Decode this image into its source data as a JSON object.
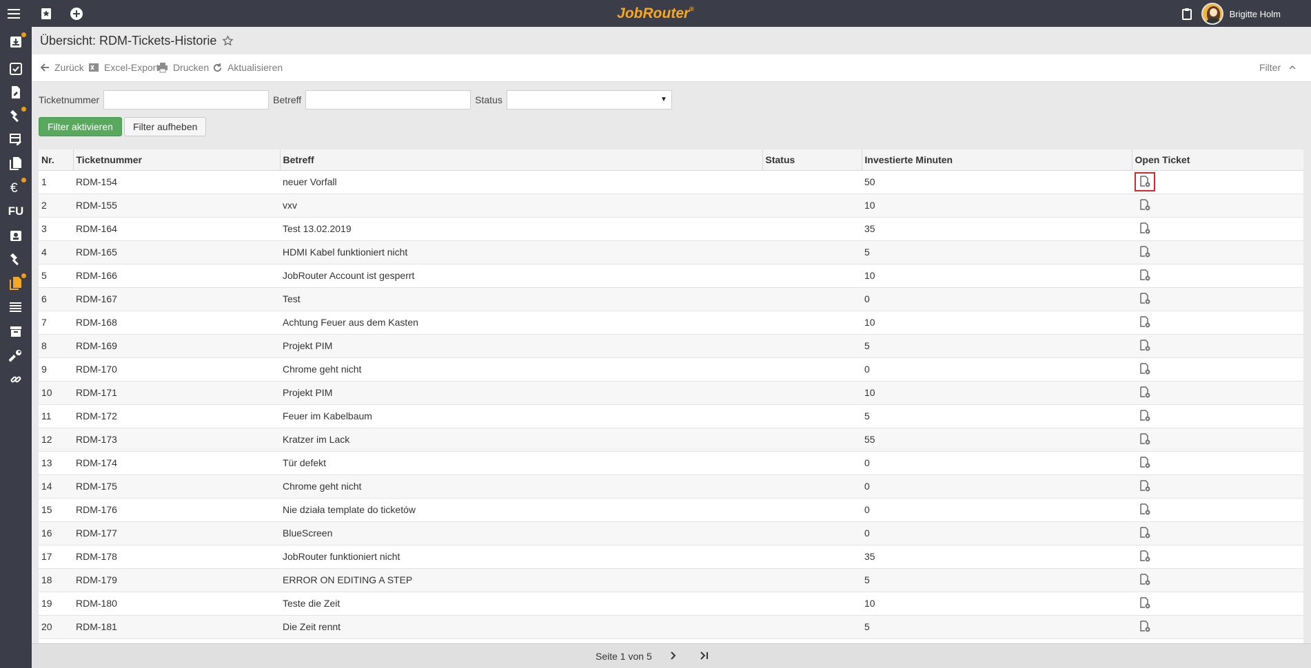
{
  "topbar": {
    "brand": "JobRouter",
    "brand_mark": "®",
    "user_name": "Brigitte Holm",
    "icons": [
      "menu-icon",
      "bookmark-icon",
      "add-circle-icon",
      "clipboard-icon",
      "avatar"
    ]
  },
  "sidebar": {
    "items": [
      {
        "icon": "inbox-icon",
        "badge": true
      },
      {
        "icon": "checkbox-icon",
        "badge": false
      },
      {
        "icon": "document-edit-icon",
        "badge": false
      },
      {
        "icon": "hammer-icon",
        "badge": true
      },
      {
        "icon": "table-edit-icon",
        "badge": false
      },
      {
        "icon": "documents-icon",
        "badge": false
      },
      {
        "icon": "euro-icon",
        "badge": true
      },
      {
        "label": "FU",
        "badge": false
      },
      {
        "icon": "contact-card-icon",
        "badge": false
      },
      {
        "icon": "hammer-icon",
        "badge": false
      },
      {
        "icon": "clipboard-files-icon",
        "badge": true,
        "active": true
      },
      {
        "icon": "list-icon",
        "badge": false
      },
      {
        "icon": "archive-icon",
        "badge": false
      },
      {
        "icon": "wrench-icon",
        "badge": false
      },
      {
        "icon": "link-icon",
        "badge": false
      }
    ]
  },
  "page": {
    "title": "Übersicht: RDM-Tickets-Historie"
  },
  "toolbar": {
    "back": "Zurück",
    "excel": "Excel-Export",
    "print": "Drucken",
    "refresh": "Aktualisieren",
    "filter": "Filter"
  },
  "filters": {
    "ticket_label": "Ticketnummer",
    "ticket_value": "",
    "subject_label": "Betreff",
    "subject_value": "",
    "status_label": "Status",
    "status_value": "",
    "apply": "Filter aktivieren",
    "clear": "Filter aufheben"
  },
  "table": {
    "columns": [
      "Nr.",
      "Ticketnummer",
      "Betreff",
      "Status",
      "Investierte Minuten",
      "Open Ticket"
    ],
    "rows": [
      {
        "nr": "1",
        "ticket": "RDM-154",
        "subject": "neuer Vorfall",
        "status": "",
        "minutes": "50"
      },
      {
        "nr": "2",
        "ticket": "RDM-155",
        "subject": "vxv",
        "status": "",
        "minutes": "10"
      },
      {
        "nr": "3",
        "ticket": "RDM-164",
        "subject": "Test 13.02.2019",
        "status": "",
        "minutes": "35"
      },
      {
        "nr": "4",
        "ticket": "RDM-165",
        "subject": "HDMI Kabel funktioniert nicht",
        "status": "",
        "minutes": "5"
      },
      {
        "nr": "5",
        "ticket": "RDM-166",
        "subject": "JobRouter Account ist gesperrt",
        "status": "",
        "minutes": "10"
      },
      {
        "nr": "6",
        "ticket": "RDM-167",
        "subject": "Test",
        "status": "",
        "minutes": "0"
      },
      {
        "nr": "7",
        "ticket": "RDM-168",
        "subject": "Achtung Feuer aus dem Kasten",
        "status": "",
        "minutes": "10"
      },
      {
        "nr": "8",
        "ticket": "RDM-169",
        "subject": "Projekt PIM",
        "status": "",
        "minutes": "5"
      },
      {
        "nr": "9",
        "ticket": "RDM-170",
        "subject": "Chrome geht nicht",
        "status": "",
        "minutes": "0"
      },
      {
        "nr": "10",
        "ticket": "RDM-171",
        "subject": "Projekt PIM",
        "status": "",
        "minutes": "10"
      },
      {
        "nr": "11",
        "ticket": "RDM-172",
        "subject": "Feuer im Kabelbaum",
        "status": "",
        "minutes": "5"
      },
      {
        "nr": "12",
        "ticket": "RDM-173",
        "subject": "Kratzer im Lack",
        "status": "",
        "minutes": "55"
      },
      {
        "nr": "13",
        "ticket": "RDM-174",
        "subject": "Tür defekt",
        "status": "",
        "minutes": "0"
      },
      {
        "nr": "14",
        "ticket": "RDM-175",
        "subject": "Chrome geht nicht",
        "status": "",
        "minutes": "0"
      },
      {
        "nr": "15",
        "ticket": "RDM-176",
        "subject": "Nie działa template do ticketów",
        "status": "",
        "minutes": "0"
      },
      {
        "nr": "16",
        "ticket": "RDM-177",
        "subject": "BlueScreen",
        "status": "",
        "minutes": "0"
      },
      {
        "nr": "17",
        "ticket": "RDM-178",
        "subject": "JobRouter funktioniert nicht",
        "status": "",
        "minutes": "35"
      },
      {
        "nr": "18",
        "ticket": "RDM-179",
        "subject": "ERROR ON EDITING A STEP",
        "status": "",
        "minutes": "5"
      },
      {
        "nr": "19",
        "ticket": "RDM-180",
        "subject": "Teste die Zeit",
        "status": "",
        "minutes": "10"
      },
      {
        "nr": "20",
        "ticket": "RDM-181",
        "subject": "Die Zeit rennt",
        "status": "",
        "minutes": "5"
      }
    ],
    "highlighted_row": 0
  },
  "pager": {
    "text": "Seite 1 von 5"
  },
  "colors": {
    "topbar": "#3b3e48",
    "brand": "#f7a823",
    "badge": "#f39c12",
    "apply_button": "#58a85e",
    "highlight": "#d9262a"
  }
}
